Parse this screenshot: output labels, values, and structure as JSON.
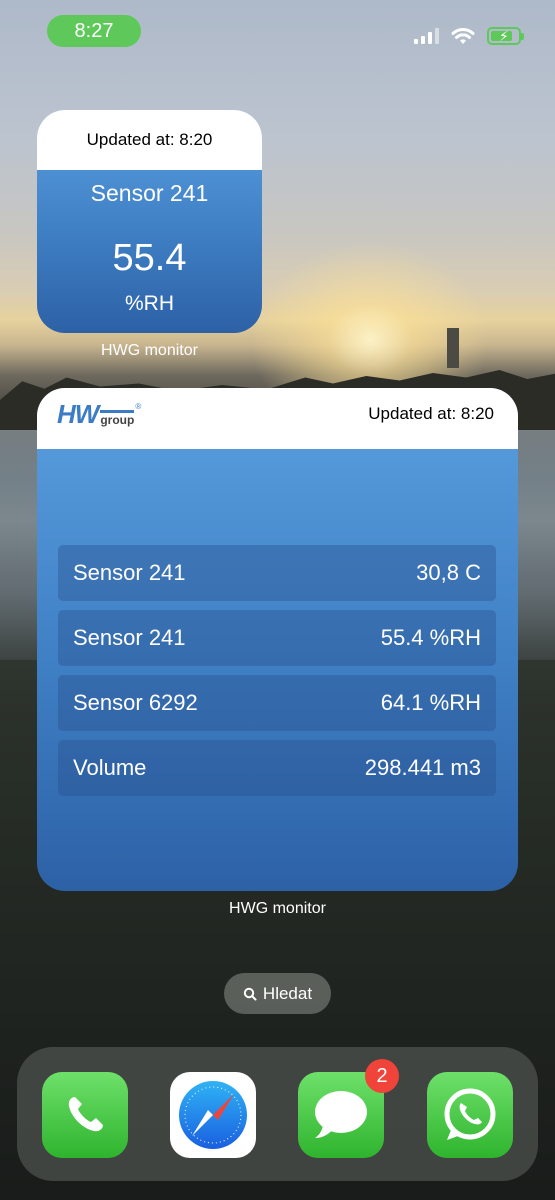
{
  "status_bar": {
    "time": "8:27"
  },
  "small_widget": {
    "updated": "Updated at: 8:20",
    "sensor_name": "Sensor 241",
    "value": "55.4",
    "unit": "%RH",
    "app_label": "HWG monitor"
  },
  "large_widget": {
    "logo_text": "HW",
    "logo_sub": "group",
    "logo_mark": "®",
    "updated": "Updated at: 8:20",
    "rows": [
      {
        "name": "Sensor 241",
        "value": "30,8 C"
      },
      {
        "name": "Sensor 241",
        "value": "55.4 %RH"
      },
      {
        "name": "Sensor 6292",
        "value": "64.1 %RH"
      },
      {
        "name": "Volume",
        "value": "298.441 m3"
      }
    ],
    "app_label": "HWG monitor"
  },
  "search": {
    "label": "Hledat"
  },
  "dock": {
    "apps": [
      "phone-icon",
      "safari-icon",
      "messages-icon",
      "whatsapp-icon"
    ],
    "messages_badge": "2"
  },
  "colors": {
    "accent_green": "#5ec95a",
    "widget_blue": "#3f7fc4",
    "badge_red": "#f0443a"
  }
}
